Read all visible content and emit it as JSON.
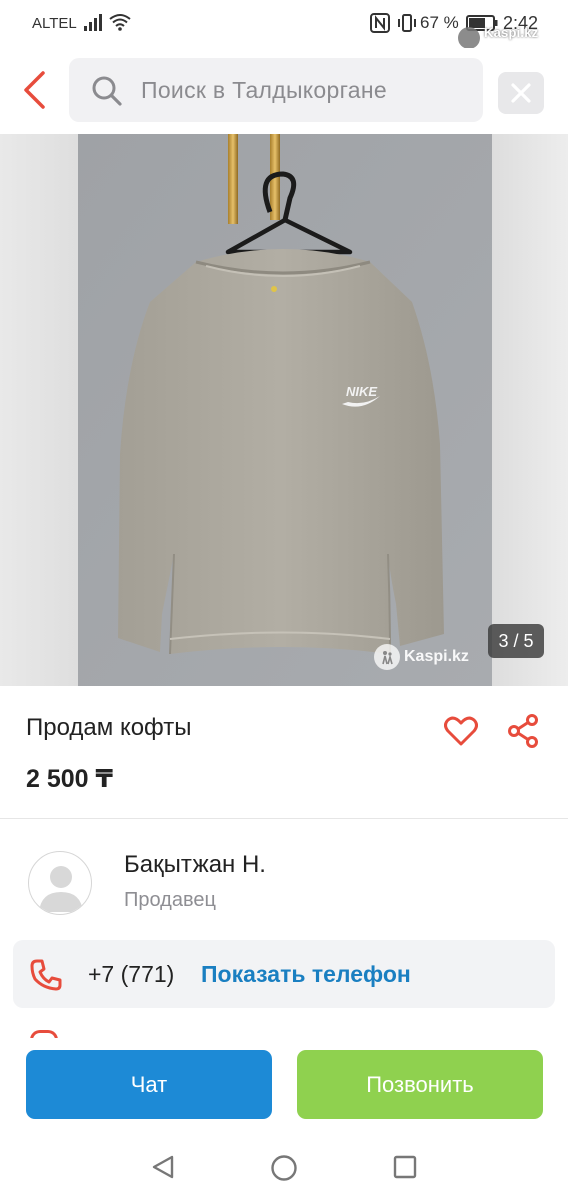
{
  "status_bar": {
    "carrier": "ALTEL",
    "battery": "67 %",
    "time": "2:42",
    "overlay_watermark": "Kaspi.kz"
  },
  "search": {
    "placeholder": "Поиск в Талдыкоргане"
  },
  "gallery": {
    "counter": "3 / 5",
    "watermark": "Kaspi.kz",
    "photo_brand_text": "NIKE"
  },
  "product": {
    "title": "Продам кофты",
    "price": "2 500 ₸"
  },
  "seller": {
    "name": "Бақытжан Н.",
    "role": "Продавец"
  },
  "contact": {
    "phone_prefix": "+7 (771)",
    "show_phone_label": "Показать телефон"
  },
  "actions": {
    "chat_label": "Чат",
    "call_label": "Позвонить"
  },
  "colors": {
    "accent_red": "#e74c3c",
    "chat_blue": "#1d8ad6",
    "call_green": "#8fd14f",
    "link_blue": "#1a7fc1"
  },
  "icons": [
    "back-arrow-icon",
    "search-icon",
    "close-icon",
    "heart-icon",
    "share-icon",
    "phone-icon",
    "avatar-placeholder-icon"
  ]
}
